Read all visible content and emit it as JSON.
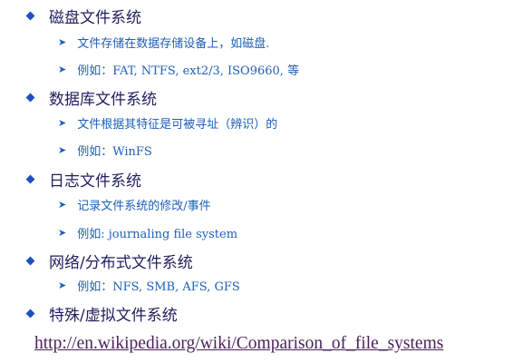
{
  "slide": {
    "items": [
      {
        "label": "磁盘文件系统"
      },
      {
        "label": "文件存储在数据存储设备上，如磁盘."
      },
      {
        "label": "例如：FAT, NTFS, ext2/3, ISO9660, 等"
      },
      {
        "label": "数据库文件系统"
      },
      {
        "label": "文件根据其特征是可被寻址（辨识）的"
      },
      {
        "label": "例如：WinFS"
      },
      {
        "label": "日志文件系统"
      },
      {
        "label": "记录文件系统的修改/事件"
      },
      {
        "label": "例如: journaling file system"
      },
      {
        "label": "网络/分布式文件系统"
      },
      {
        "label": "例如：NFS, SMB, AFS, GFS"
      },
      {
        "label": "特殊/虚拟文件系统"
      }
    ],
    "link": "http://en.wikipedia.org/wiki/Comparison_of_file_systems"
  },
  "colors": {
    "heading": "#1f1f5f",
    "sub_item": "#1e5fb8",
    "bullet": "#1f4fbf",
    "link": "#4a1f5a"
  },
  "icons": {
    "level1": "diamond-bullet-icon",
    "level2": "arrow-bullet-icon"
  }
}
